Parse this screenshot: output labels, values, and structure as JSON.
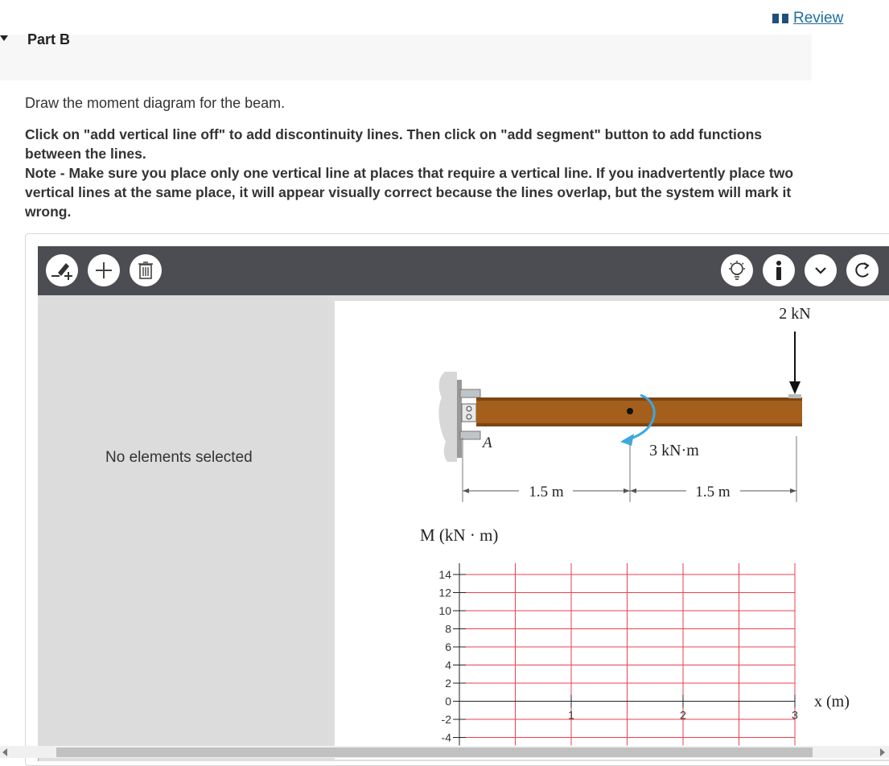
{
  "header": {
    "review_label": "Review",
    "part_label": "Part B"
  },
  "content": {
    "instruction": "Draw the moment diagram for the beam.",
    "bold_line1": "Click on \"add vertical line off\" to add discontinuity lines. Then click on \"add segment\" button to add functions between the lines.",
    "bold_line2": "Note - Make sure you place only one vertical line at places that require a vertical line. If you inadvertently place two vertical lines at the same place, it will appear visually correct because the lines overlap, but the system will mark it wrong."
  },
  "toolbar": {
    "left_icons": [
      "add-vertical-line-icon",
      "add-segment-icon",
      "trash-icon"
    ],
    "right_icons": [
      "hint-lightbulb-icon",
      "info-icon",
      "chevron-down-icon",
      "reset-icon"
    ]
  },
  "sidebar": {
    "empty_text": "No elements selected"
  },
  "figure": {
    "load_label": "2 kN",
    "moment_label": "3 kN·m",
    "support_label": "A",
    "dim_left": "1.5 m",
    "dim_right": "1.5 m",
    "y_axis_label": "M (kN · m)",
    "x_axis_label": "x (m)",
    "y_ticks": [
      "14",
      "12",
      "10",
      "8",
      "6",
      "4",
      "2",
      "0",
      "-2",
      "-4"
    ],
    "x_ticks": [
      "1",
      "2",
      "3"
    ],
    "x_tick_values": [
      1,
      2,
      3
    ],
    "y_tick_values": [
      14,
      12,
      10,
      8,
      6,
      4,
      2,
      0,
      -2,
      -4
    ],
    "grid_color": "#e8424f"
  }
}
